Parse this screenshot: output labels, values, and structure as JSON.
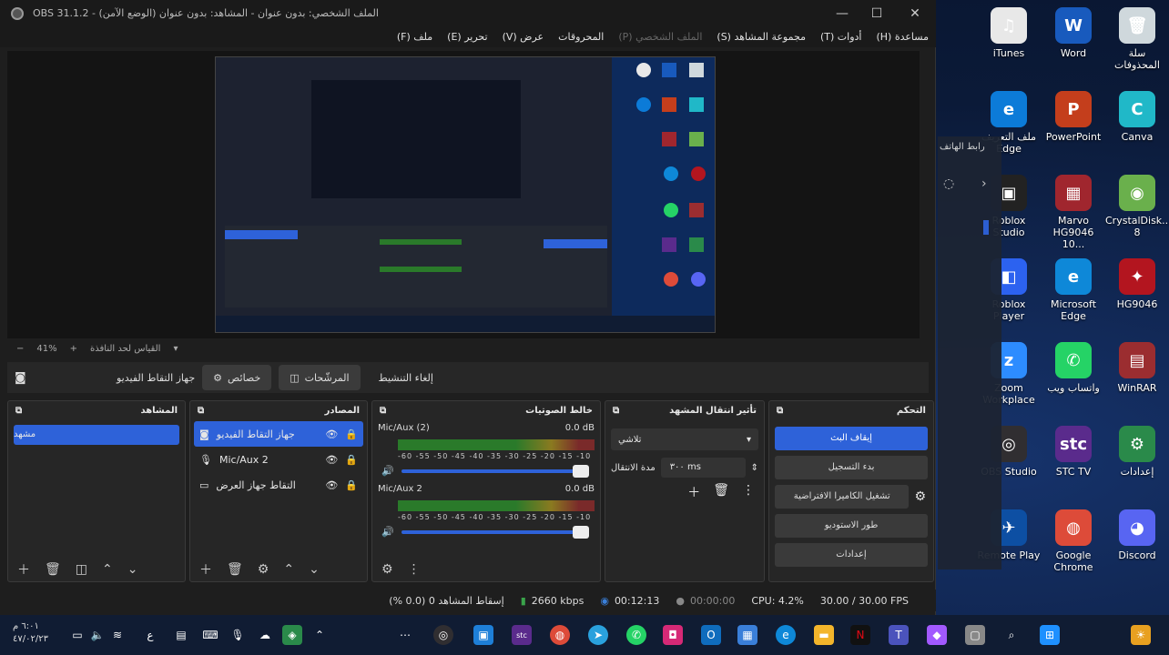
{
  "window": {
    "title": "OBS 31.1.2 - الملف الشخصي: بدون عنوان - المشاهد: بدون عنوان (الوضع الآمن)"
  },
  "menu": [
    {
      "label": "ملف (F)"
    },
    {
      "label": "تحرير (E)"
    },
    {
      "label": "عرض (V)"
    },
    {
      "label": "المحروقات"
    },
    {
      "label": "الملف الشخصي (P)",
      "dim": true
    },
    {
      "label": "مجموعة المشاهد (S)"
    },
    {
      "label": "أدوات (T)"
    },
    {
      "label": "مساعدة (H)"
    }
  ],
  "zoom": {
    "minus": "−",
    "value": "41%",
    "plus": "+",
    "fit_label": "القياس لحد النافذة"
  },
  "source_toolbar": {
    "source_name": "جهاز التقاط الفيديو",
    "properties": "خصائص",
    "filters": "المرشّحات",
    "deactivate": "إلغاء التنشيط"
  },
  "scenes": {
    "title": "المشاهد",
    "items": [
      "مشهد"
    ]
  },
  "sources": {
    "title": "المصادر",
    "items": [
      {
        "name": "جهاز التقاط الفيديو",
        "icon": "camera-icon",
        "selected": true
      },
      {
        "name": "Mic/Aux 2",
        "icon": "microphone-icon",
        "selected": false
      },
      {
        "name": "التقاط جهاز العرض",
        "icon": "monitor-icon",
        "selected": false
      }
    ]
  },
  "mixer": {
    "title": "خالط الصوتيات",
    "channels": [
      {
        "name": "Mic/Aux (2)",
        "db": "0.0 dB",
        "scale": "-60 -55 -50 -45 -40 -35 -30 -25 -20 -15 -10 -5 0"
      },
      {
        "name": "Mic/Aux 2",
        "db": "0.0 dB",
        "scale": "-60 -55 -50 -45 -40 -35 -30 -25 -20 -15 -10 -5 0"
      }
    ]
  },
  "transitions": {
    "title": "تأثير انتقال المشهد",
    "type": "تلاشي",
    "duration_label": "مدة الانتقال",
    "duration_value": "٣٠٠ ms"
  },
  "controls": {
    "title": "التحكم",
    "stop_stream": "إيقاف البث",
    "start_recording": "بدء التسجيل",
    "virtual_camera": "تشغيل الكاميرا الافتراضية",
    "studio_mode": "طور الاستوديو",
    "settings": "إعدادات"
  },
  "status": {
    "dropped": "إسقاط المشاهد 0 (0.0 %)",
    "bitrate": "2660 kbps",
    "stream_time": "00:12:13",
    "record_time": "00:00:00",
    "cpu": "CPU: 4.2%",
    "fps": "30.00 / 30.00 FPS"
  },
  "phone_link": {
    "label": "رابط الهاتف"
  },
  "desktop_icons": [
    {
      "label": "iTunes",
      "color": "#e8e8e8",
      "glyph": "♫"
    },
    {
      "label": "Word",
      "color": "#185abd",
      "glyph": "W"
    },
    {
      "label": "سلة المحذوفات",
      "color": "#cfd8dc",
      "glyph": "🗑"
    },
    {
      "label": "ملف التعريف Edge",
      "color": "#0c7bd8",
      "glyph": "e"
    },
    {
      "label": "PowerPoint",
      "color": "#c43e1c",
      "glyph": "P"
    },
    {
      "label": "Canva",
      "color": "#20b8c8",
      "glyph": "C"
    },
    {
      "label": "Roblox Studio",
      "color": "#222222",
      "glyph": "▣"
    },
    {
      "label": "Marvo HG9046 10...",
      "color": "#a0262e",
      "glyph": "▦"
    },
    {
      "label": "CrystalDisk... 8",
      "color": "#6ab04c",
      "glyph": "◉"
    },
    {
      "label": "Roblox Player",
      "color": "#2c62f0",
      "glyph": "◧"
    },
    {
      "label": "Microsoft Edge",
      "color": "#0e88d8",
      "glyph": "e"
    },
    {
      "label": "HG9046",
      "color": "#b3151f",
      "glyph": "✦"
    },
    {
      "label": "Zoom Workplace",
      "color": "#2d8cff",
      "glyph": "z"
    },
    {
      "label": "واتساب ويب",
      "color": "#25d366",
      "glyph": "✆"
    },
    {
      "label": "WinRAR",
      "color": "#9b2d30",
      "glyph": "▤"
    },
    {
      "label": "OBS Studio",
      "color": "#302e31",
      "glyph": "◎"
    },
    {
      "label": "STC TV",
      "color": "#5a2b8c",
      "glyph": "stc"
    },
    {
      "label": "إعدادات",
      "color": "#2a8a4a",
      "glyph": "⚙"
    },
    {
      "label": "Remote Play",
      "color": "#0d4fa3",
      "glyph": "✈"
    },
    {
      "label": "Google Chrome",
      "color": "#dd4b39",
      "glyph": "◍"
    },
    {
      "label": "Discord",
      "color": "#5865f2",
      "glyph": "◕"
    }
  ],
  "taskbar": {
    "time": "٦:٠١ م",
    "date": "٤٧/٠٢/٢٣"
  }
}
